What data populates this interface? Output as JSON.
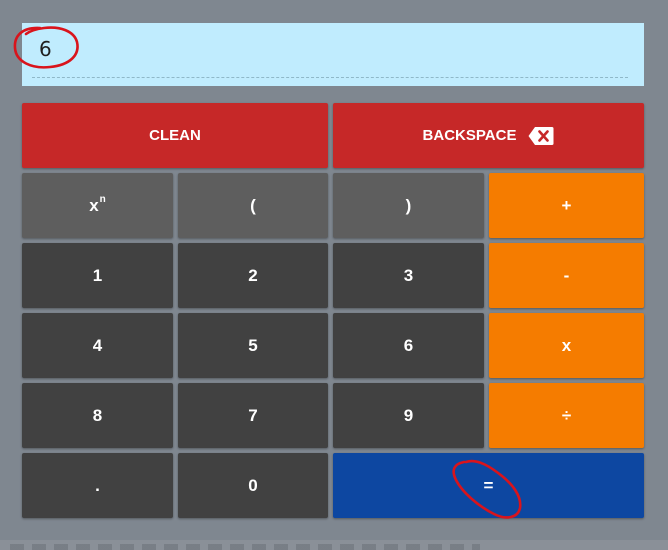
{
  "display": {
    "value": "6"
  },
  "buttons": {
    "clean": "CLEAN",
    "backspace": "BACKSPACE",
    "power_base": "x",
    "power_exp": "n",
    "open_paren": "(",
    "close_paren": ")",
    "plus": "+",
    "one": "1",
    "two": "2",
    "three": "3",
    "minus": "-",
    "four": "4",
    "five": "5",
    "six": "6",
    "multiply": "x",
    "eight": "8",
    "seven": "7",
    "nine": "9",
    "divide": "÷",
    "dot": ".",
    "zero": "0",
    "equals": "="
  },
  "colors": {
    "display_bg": "#c0ecfe",
    "red": "#c62828",
    "gray": "#5e5e5e",
    "dark": "#414141",
    "orange": "#f57c00",
    "blue": "#0d47a1",
    "annotation": "#d9141c"
  },
  "icons": {
    "backspace": "backspace-icon"
  }
}
